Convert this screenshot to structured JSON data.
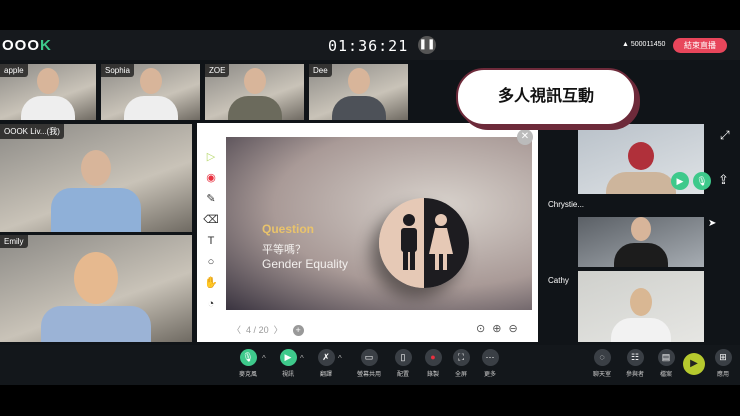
{
  "header": {
    "logo": "OOOK",
    "timer": "01:36:21",
    "user_id": "500011450",
    "end_button": "結束直播"
  },
  "participants_top": [
    {
      "name": "apple"
    },
    {
      "name": "Sophia"
    },
    {
      "name": "ZOE"
    },
    {
      "name": "Dee"
    }
  ],
  "participants_left": [
    {
      "name": "OOOK Liv...(我)"
    },
    {
      "name": "Emily"
    }
  ],
  "participants_right": [
    {
      "name": "Chrystie..."
    },
    {
      "name": "Cathy"
    }
  ],
  "callout": "多人視訊互動",
  "slide": {
    "title": "Question",
    "line1": "平等嗎？",
    "line2": "Gender Equality",
    "page": "4",
    "total": "20"
  },
  "toolbar": {
    "items": [
      {
        "label": "麥克風",
        "icon": "mic-icon"
      },
      {
        "label": "視訊",
        "icon": "camera-icon"
      },
      {
        "label": "翻譯",
        "icon": "translate-icon"
      },
      {
        "label": "螢幕共用",
        "icon": "screen-share-icon"
      },
      {
        "label": "配置",
        "icon": "layout-icon"
      },
      {
        "label": "錄製",
        "icon": "record-icon"
      },
      {
        "label": "全屏",
        "icon": "fullscreen-icon"
      },
      {
        "label": "更多",
        "icon": "more-icon"
      }
    ],
    "right_items": [
      {
        "label": "聊天室",
        "icon": "chat-icon"
      },
      {
        "label": "參與者",
        "icon": "participants-icon"
      },
      {
        "label": "檔案",
        "icon": "file-icon"
      },
      {
        "label": "應用",
        "icon": "apps-icon"
      }
    ]
  },
  "colors": {
    "accent": "#3ec98b",
    "end": "#e8465b",
    "callout_border": "#6d2a3a"
  }
}
